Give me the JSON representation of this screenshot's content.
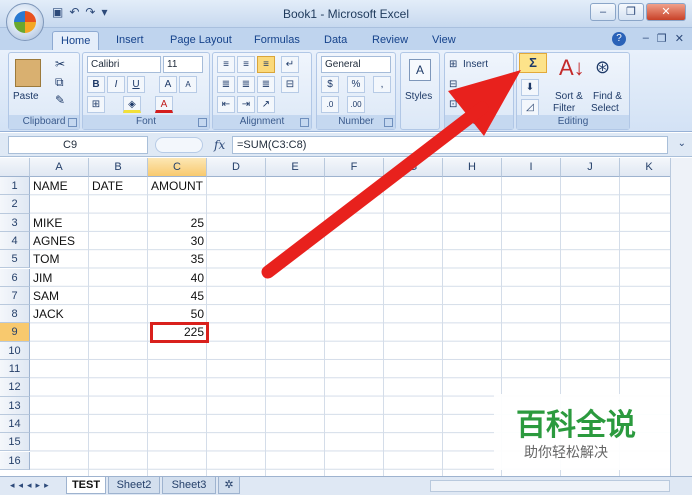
{
  "window": {
    "title": "Book1 - Microsoft Excel"
  },
  "tabs": [
    "Home",
    "Insert",
    "Page Layout",
    "Formulas",
    "Data",
    "Review",
    "View"
  ],
  "ribbon": {
    "clipboard": {
      "paste": "Paste",
      "label": "Clipboard"
    },
    "font": {
      "name": "Calibri",
      "size": "11",
      "label": "Font"
    },
    "alignment": {
      "label": "Alignment"
    },
    "number": {
      "format": "General",
      "label": "Number"
    },
    "styles": {
      "label": "Styles"
    },
    "cells": {
      "insert": "Insert",
      "label": "Cel"
    },
    "editing": {
      "autosum": "Σ",
      "sort_line1": "Sort &",
      "sort_line2": "Filter",
      "find_line1": "Find &",
      "find_line2": "Select",
      "label": "Editing"
    }
  },
  "formula_bar": {
    "name_box": "C9",
    "fx": "fx",
    "formula": "=SUM(C3:C8)"
  },
  "columns": [
    "A",
    "B",
    "C",
    "D",
    "E",
    "F",
    "G",
    "H",
    "I",
    "J",
    "K"
  ],
  "rows": [
    "1",
    "2",
    "3",
    "4",
    "5",
    "6",
    "7",
    "8",
    "9",
    "10",
    "11",
    "12",
    "13",
    "14",
    "15",
    "16"
  ],
  "cells": {
    "A1": "NAME",
    "B1": "DATE",
    "C1": "AMOUNT",
    "A3": "MIKE",
    "C3": "25",
    "A4": "AGNES",
    "C4": "30",
    "A5": "TOM",
    "C5": "35",
    "A6": "JIM",
    "C6": "40",
    "A7": "SAM",
    "C7": "45",
    "A8": "JACK",
    "C8": "50",
    "C9": "225"
  },
  "sheets": [
    "TEST",
    "Sheet2",
    "Sheet3"
  ],
  "watermark": {
    "big": "百科全说",
    "small": "助你轻松解决"
  },
  "colors": {
    "arrow": "#e8211d",
    "selection": "#d9201c",
    "watermark_green": "#2b9a3e"
  }
}
